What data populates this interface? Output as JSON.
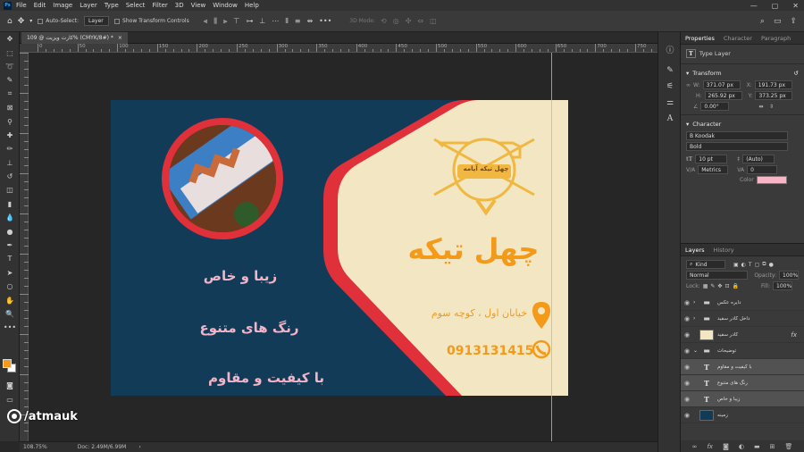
{
  "menubar": {
    "app_icon": "Ps",
    "items": [
      "File",
      "Edit",
      "Image",
      "Layer",
      "Type",
      "Select",
      "Filter",
      "3D",
      "View",
      "Window",
      "Help"
    ],
    "window_controls": [
      "—",
      "▢",
      "✕"
    ]
  },
  "options": {
    "auto_select_label": "Auto-Select:",
    "auto_select_value": "Layer",
    "transform_controls_label": "Show Transform Controls",
    "mode_3d_label": "3D Mode:",
    "icons": [
      "home-icon",
      "move-icon",
      "align-icons",
      "3d-icons",
      "search-icon",
      "workspace-icon",
      "share-icon"
    ]
  },
  "document": {
    "tab_title": "کارت ویزیت @ 109% (CMYK/8#) *",
    "tab_close": "×"
  },
  "ruler": {
    "labels": [
      "0",
      "50",
      "100",
      "150",
      "200",
      "250",
      "300",
      "350",
      "400",
      "450",
      "500",
      "550",
      "600",
      "650",
      "700",
      "750"
    ]
  },
  "card": {
    "slogans": [
      "زیبا و خاص",
      "رنگ های متنوع",
      "با کیفیت و مقاوم"
    ],
    "brand": "چهل تیکه",
    "logo_text": "چهل تیکه آپامه",
    "address": "خیابان اول ، کوچه سوم",
    "phone": "0913131415",
    "colors": {
      "navy": "#123b57",
      "cream": "#f3e6c3",
      "red": "#e0313a",
      "orange": "#f39a1a",
      "pink": "#f4b3c7"
    }
  },
  "status": {
    "zoom": "108.75%",
    "doc_size": "Doc: 2.49M/6.99M",
    "arrow": "›"
  },
  "watermark": {
    "text": "/atmauk"
  },
  "properties": {
    "tabs": [
      "Properties",
      "Character",
      "Paragraph"
    ],
    "type_layer_label": "Type Layer",
    "transform_header": "Transform",
    "w_label": "W:",
    "w_value": "371.07 px",
    "x_label": "X:",
    "x_value": "191.73 px",
    "h_label": "H:",
    "h_value": "265.92 px",
    "y_label": "Y:",
    "y_value": "373.25 px",
    "angle_value": "0.00°",
    "character_header": "Character",
    "font_family": "B Koodak",
    "font_style": "Bold",
    "font_size": "10 pt",
    "leading": "(Auto)",
    "kerning": "Metrics",
    "tracking": "0",
    "color_label": "Color",
    "text_color": "#f7b6c6"
  },
  "layers_panel": {
    "tabs": [
      "Layers",
      "History"
    ],
    "kind_label": "Kind",
    "blend_mode": "Normal",
    "opacity_label": "Opacity:",
    "opacity_value": "100%",
    "lock_label": "Lock:",
    "fill_label": "Fill:",
    "fill_value": "100%",
    "layers": [
      {
        "name": "دایره عکس",
        "kind": "folder",
        "selected": false
      },
      {
        "name": "داخل کادر سفید",
        "kind": "folder",
        "selected": false
      },
      {
        "name": "کادر سفید",
        "kind": "image",
        "selected": false,
        "fx": "fx"
      },
      {
        "name": "توضیحات",
        "kind": "folder",
        "selected": false
      },
      {
        "name": "با کیفیت و مقاوم",
        "kind": "text",
        "selected": true
      },
      {
        "name": "رنگ های متنوع",
        "kind": "text",
        "selected": true
      },
      {
        "name": "زیبا و خاص",
        "kind": "text",
        "selected": true
      },
      {
        "name": "زمینه",
        "kind": "background",
        "selected": false
      }
    ]
  }
}
